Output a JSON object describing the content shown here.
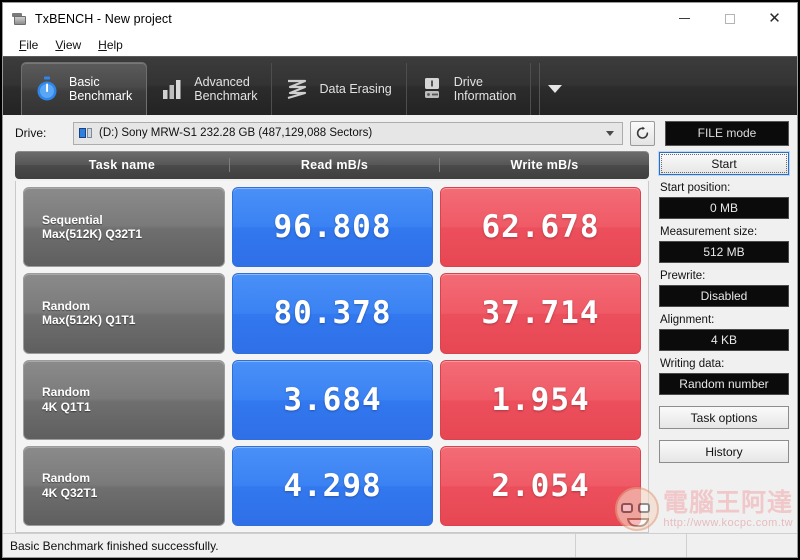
{
  "window": {
    "title": "TxBENCH - New project",
    "app_icon": "drive-icon",
    "controls": {
      "minimize": "–",
      "maximize": "□",
      "close": "✕"
    }
  },
  "menu": [
    {
      "label": "File",
      "accel": "F"
    },
    {
      "label": "View",
      "accel": "V"
    },
    {
      "label": "Help",
      "accel": "H"
    }
  ],
  "tabs": [
    {
      "line1": "Basic",
      "line2": "Benchmark",
      "icon": "stopwatch-icon",
      "active": true
    },
    {
      "line1": "Advanced",
      "line2": "Benchmark",
      "icon": "bar-chart-icon",
      "active": false
    },
    {
      "line1": "Data Erasing",
      "line2": "",
      "icon": "data-erasing-icon",
      "active": false
    },
    {
      "line1": "Drive",
      "line2": "Information",
      "icon": "drive-information-icon",
      "active": false
    }
  ],
  "tab_overflow_icon": "chevron-down-icon",
  "drive_row": {
    "label": "Drive:",
    "selected": "(D:) Sony MRW-S1  232.28 GB (487,129,088 Sectors)",
    "drive_icon": "removable-drive-icon",
    "refresh_icon": "refresh-icon",
    "mode_button": "FILE mode"
  },
  "results": {
    "headers": {
      "task": "Task name",
      "read": "Read mB/s",
      "write": "Write mB/s"
    },
    "rows": [
      {
        "name_line1": "Sequential",
        "name_line2": "Max(512K) Q32T1",
        "read": "96.808",
        "write": "62.678"
      },
      {
        "name_line1": "Random",
        "name_line2": "Max(512K) Q1T1",
        "read": "80.378",
        "write": "37.714"
      },
      {
        "name_line1": "Random",
        "name_line2": "4K Q1T1",
        "read": "3.684",
        "write": "1.954"
      },
      {
        "name_line1": "Random",
        "name_line2": "4K Q32T1",
        "read": "4.298",
        "write": "2.054"
      }
    ]
  },
  "sidebar": {
    "start_button": "Start",
    "start_position_label": "Start position:",
    "start_position_value": "0 MB",
    "measurement_size_label": "Measurement size:",
    "measurement_size_value": "512 MB",
    "prewrite_label": "Prewrite:",
    "prewrite_value": "Disabled",
    "alignment_label": "Alignment:",
    "alignment_value": "4 KB",
    "writing_data_label": "Writing data:",
    "writing_data_value": "Random number",
    "task_options_button": "Task options",
    "history_button": "History"
  },
  "statusbar": {
    "message": "Basic Benchmark finished successfully."
  },
  "watermark": {
    "name": "電腦王阿達",
    "url": "http://www.kocpc.com.tw"
  },
  "colors": {
    "read_cell": "#3a82f3",
    "write_cell": "#ef5a66",
    "tab_strip": "#333333",
    "task_cell": "#7a7a7a",
    "value_field": "#0b0b0b"
  },
  "chart_data": {
    "type": "bar",
    "title": "TxBENCH Basic Benchmark results",
    "categories": [
      "Sequential Max(512K) Q32T1",
      "Random Max(512K) Q1T1",
      "Random 4K Q1T1",
      "Random 4K Q32T1"
    ],
    "series": [
      {
        "name": "Read mB/s",
        "values": [
          96.808,
          80.378,
          3.684,
          4.298
        ]
      },
      {
        "name": "Write mB/s",
        "values": [
          62.678,
          37.714,
          1.954,
          2.054
        ]
      }
    ],
    "xlabel": "Task name",
    "ylabel": "mB/s",
    "legend": "right"
  }
}
